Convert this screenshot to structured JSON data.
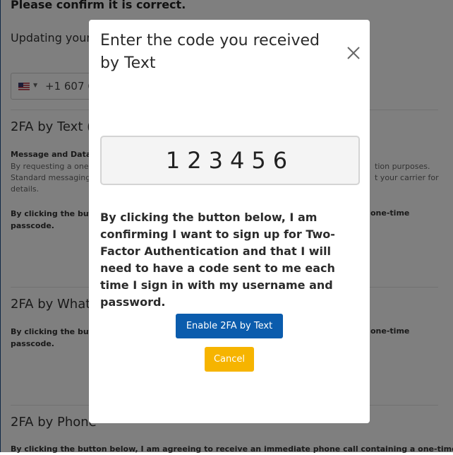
{
  "background": {
    "confirm_heading": "Please confirm it is correct.",
    "updating_text": "Updating your",
    "phone_prefix": "+1 607 6",
    "section_text_title": "2FA by Text (S",
    "msg_data_label": "Message and Data R",
    "msg_line1": "By requesting a one-t",
    "msg_line2": "Standard messaging a",
    "msg_line3": "details.",
    "msg_right1": "tion purposes.",
    "msg_right2": "t your carrier for",
    "consent_text_1": "By clicking the butto",
    "consent_text_1b": "passcode.",
    "consent_right_1": "one-time",
    "section_whatsapp_title": "2FA by Whats",
    "consent_text_2": "By clicking the butto",
    "consent_text_2b": "passcode.",
    "consent_right_2": "one-time",
    "section_phone_title": "2FA by Phone",
    "consent_text_3": "By clicking the button below, I am agreeing to receive an immediate phone call containing a one-time"
  },
  "modal": {
    "title": "Enter the code you received by Text",
    "code_value": "123456",
    "body_text": "By clicking the button below, I am confirming I want to sign up for Two-Factor Authentication and that I will need to have a code sent to me each time I sign in with my username and password.",
    "enable_button": "Enable 2FA by Text",
    "cancel_button": "Cancel"
  },
  "colors": {
    "primary": "#0b5cad",
    "warning": "#f6b400",
    "overlay": "rgba(0,0,0,0.5)"
  }
}
